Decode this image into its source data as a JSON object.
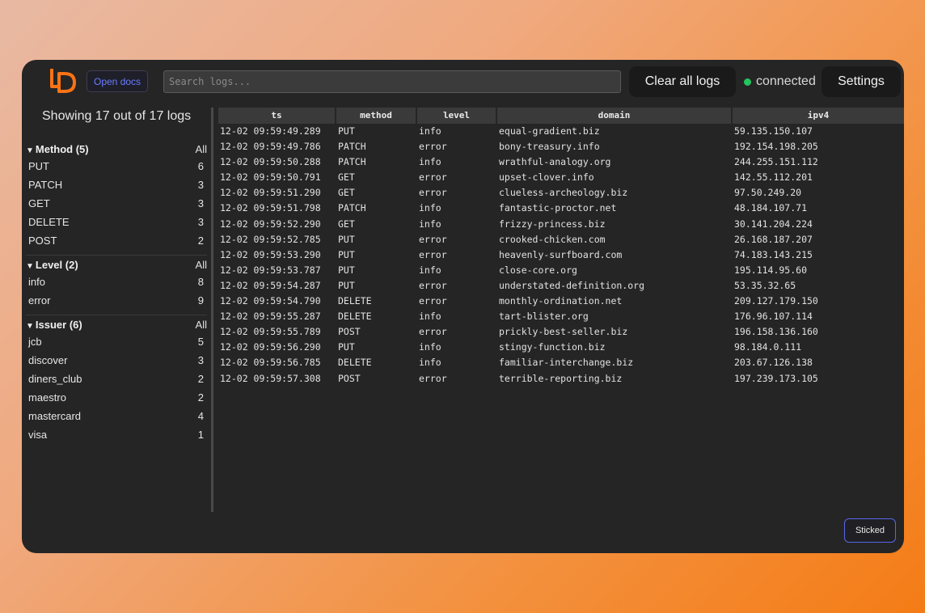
{
  "header": {
    "logo_icon": "ld-logo-icon",
    "docs_label": "Open docs",
    "search_placeholder": "Search logs...",
    "search_value": "",
    "clear_label": "Clear all logs",
    "status_label": "connected",
    "status_color": "#22c55e",
    "settings_label": "Settings"
  },
  "sidebar": {
    "showing": "Showing 17 out of 17 logs",
    "groups": [
      {
        "title": "Method (5)",
        "all": "All",
        "items": [
          {
            "label": "PUT",
            "count": "6"
          },
          {
            "label": "PATCH",
            "count": "3"
          },
          {
            "label": "GET",
            "count": "3"
          },
          {
            "label": "DELETE",
            "count": "3"
          },
          {
            "label": "POST",
            "count": "2"
          }
        ]
      },
      {
        "title": "Level (2)",
        "all": "All",
        "items": [
          {
            "label": "info",
            "count": "8"
          },
          {
            "label": "error",
            "count": "9"
          }
        ]
      },
      {
        "title": "Issuer (6)",
        "all": "All",
        "items": [
          {
            "label": "jcb",
            "count": "5"
          },
          {
            "label": "discover",
            "count": "3"
          },
          {
            "label": "diners_club",
            "count": "2"
          },
          {
            "label": "maestro",
            "count": "2"
          },
          {
            "label": "mastercard",
            "count": "4"
          },
          {
            "label": "visa",
            "count": "1"
          }
        ]
      }
    ]
  },
  "table": {
    "columns": [
      "ts",
      "method",
      "level",
      "domain",
      "ipv4"
    ],
    "rows": [
      [
        "12-02 09:59:49.289",
        "PUT",
        "info",
        "equal-gradient.biz",
        "59.135.150.107"
      ],
      [
        "12-02 09:59:49.786",
        "PATCH",
        "error",
        "bony-treasury.info",
        "192.154.198.205"
      ],
      [
        "12-02 09:59:50.288",
        "PATCH",
        "info",
        "wrathful-analogy.org",
        "244.255.151.112"
      ],
      [
        "12-02 09:59:50.791",
        "GET",
        "error",
        "upset-clover.info",
        "142.55.112.201"
      ],
      [
        "12-02 09:59:51.290",
        "GET",
        "error",
        "clueless-archeology.biz",
        "97.50.249.20"
      ],
      [
        "12-02 09:59:51.798",
        "PATCH",
        "info",
        "fantastic-proctor.net",
        "48.184.107.71"
      ],
      [
        "12-02 09:59:52.290",
        "GET",
        "info",
        "frizzy-princess.biz",
        "30.141.204.224"
      ],
      [
        "12-02 09:59:52.785",
        "PUT",
        "error",
        "crooked-chicken.com",
        "26.168.187.207"
      ],
      [
        "12-02 09:59:53.290",
        "PUT",
        "error",
        "heavenly-surfboard.com",
        "74.183.143.215"
      ],
      [
        "12-02 09:59:53.787",
        "PUT",
        "info",
        "close-core.org",
        "195.114.95.60"
      ],
      [
        "12-02 09:59:54.287",
        "PUT",
        "error",
        "understated-definition.org",
        "53.35.32.65"
      ],
      [
        "12-02 09:59:54.790",
        "DELETE",
        "error",
        "monthly-ordination.net",
        "209.127.179.150"
      ],
      [
        "12-02 09:59:55.287",
        "DELETE",
        "info",
        "tart-blister.org",
        "176.96.107.114"
      ],
      [
        "12-02 09:59:55.789",
        "POST",
        "error",
        "prickly-best-seller.biz",
        "196.158.136.160"
      ],
      [
        "12-02 09:59:56.290",
        "PUT",
        "info",
        "stingy-function.biz",
        "98.184.0.111"
      ],
      [
        "12-02 09:59:56.785",
        "DELETE",
        "info",
        "familiar-interchange.biz",
        "203.67.126.138"
      ],
      [
        "12-02 09:59:57.308",
        "POST",
        "error",
        "terrible-reporting.biz",
        "197.239.173.105"
      ]
    ]
  },
  "footer": {
    "sticked_label": "Sticked"
  }
}
